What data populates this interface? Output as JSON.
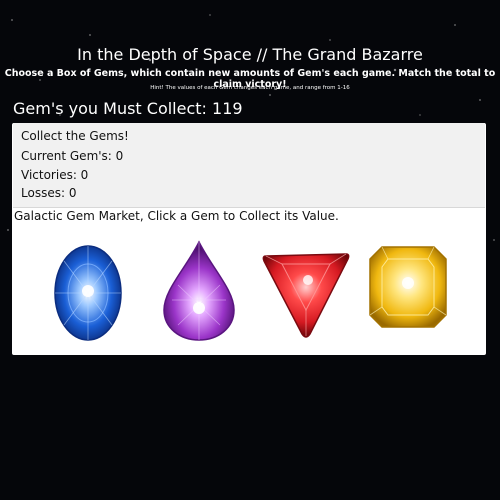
{
  "header": {
    "title": "In the Depth of Space // The Grand Bazarre",
    "subtitle": "Choose a Box of Gems, which contain new amounts of Gem's each game. Match the total to claim victory!",
    "hint": "Hint! The values of each Gem changes each game, and range from 1-16"
  },
  "target": {
    "label": "Gem's you Must Collect: 119"
  },
  "status": {
    "heading": "Collect the Gems!",
    "current": "Current Gem's: 0",
    "victories": "Victories: 0",
    "losses": "Losses: 0"
  },
  "market": {
    "label": "Galactic Gem Market, Click a Gem to Collect its Value."
  },
  "gems": [
    {
      "name": "sapphire-gem",
      "color": "#1a5fd6"
    },
    {
      "name": "amethyst-gem",
      "color": "#9b35c9"
    },
    {
      "name": "ruby-gem",
      "color": "#d61a22"
    },
    {
      "name": "topaz-gem",
      "color": "#f0b810"
    }
  ]
}
